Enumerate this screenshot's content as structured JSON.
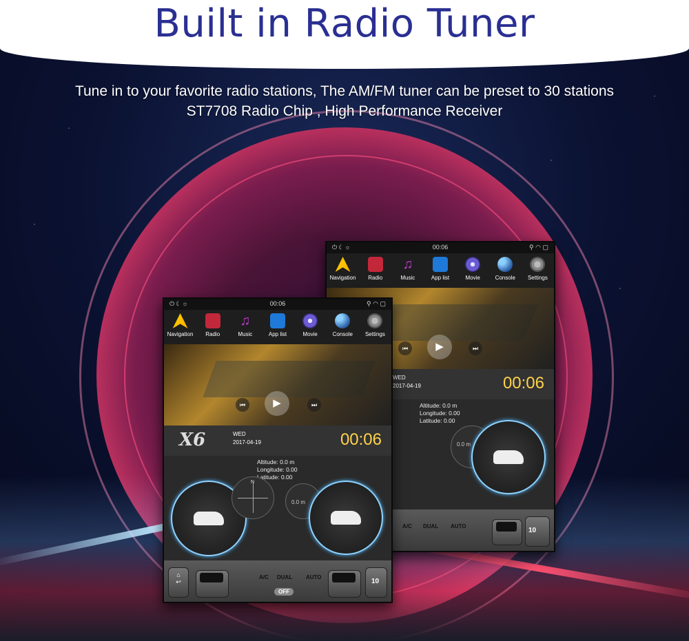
{
  "header": {
    "title": "Built in  Radio Tuner"
  },
  "intro": {
    "line1": "Tune in to your favorite radio stations, The AM/FM tuner can be preset to 30 stations",
    "line2": "ST7708 Radio Chip , High Performance Receiver"
  },
  "status": {
    "time": "00:06"
  },
  "apps": [
    {
      "label": "Navigation",
      "icon": "navigation-icon"
    },
    {
      "label": "Radio",
      "icon": "radio-icon"
    },
    {
      "label": "Music",
      "icon": "music-icon"
    },
    {
      "label": "App list",
      "icon": "app-list-icon"
    },
    {
      "label": "Movie",
      "icon": "movie-icon"
    },
    {
      "label": "Console",
      "icon": "console-icon"
    },
    {
      "label": "Settings",
      "icon": "settings-icon"
    }
  ],
  "info": {
    "logo": "X6",
    "day": "WED",
    "date": "2017-04-19",
    "clock": "00:06"
  },
  "gps": {
    "altitude": "Altitude:  0.0 m",
    "longitude": "Longitude:  0.00",
    "latitude": "Latitude:  0.00",
    "alt_gauge": "0.0 m",
    "compass_n": "N"
  },
  "climate": {
    "ac": "A/C",
    "dual": "DUAL",
    "auto": "AUTO",
    "off": "OFF",
    "volume": "10"
  },
  "colors": {
    "title": "#2a2f92",
    "clock": "#ffd34a",
    "gauge_glow": "#8fd3ff"
  }
}
